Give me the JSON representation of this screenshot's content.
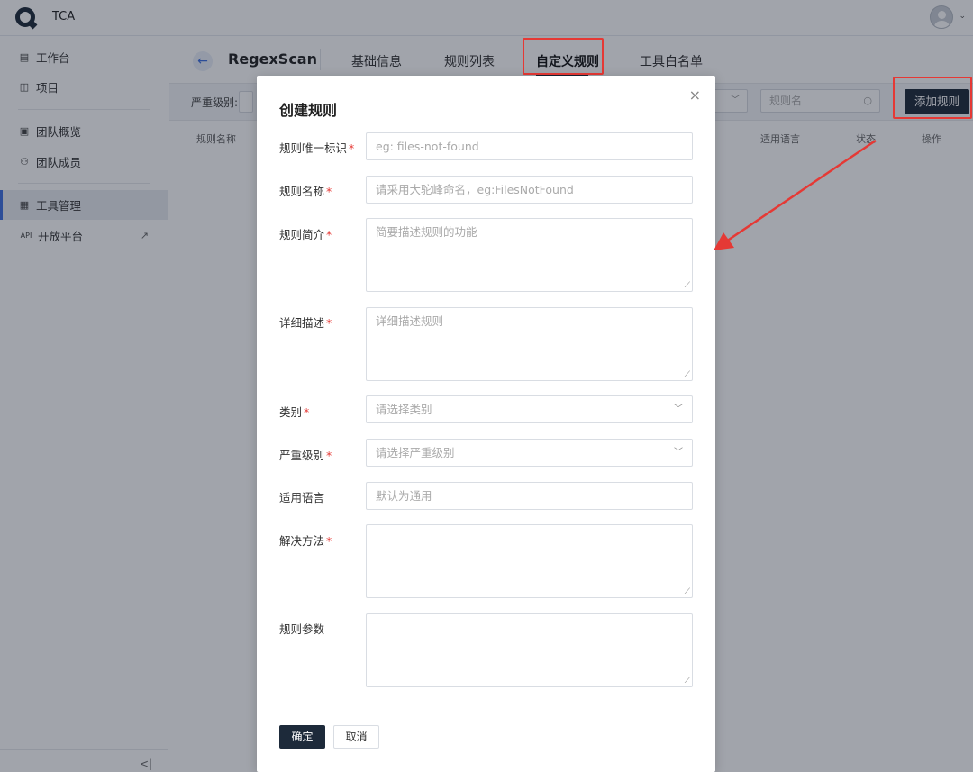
{
  "app": {
    "brand": "TCA"
  },
  "sidebar": {
    "items": [
      {
        "icon": "▤",
        "label": "工作台"
      },
      {
        "icon": "◫",
        "label": "项目"
      },
      {
        "icon": "▣",
        "label": "团队概览"
      },
      {
        "icon": "⚇",
        "label": "团队成员"
      },
      {
        "icon": "▦",
        "label": "工具管理"
      },
      {
        "icon": "API",
        "label": "开放平台",
        "ext": "↗"
      }
    ],
    "collapse": "<|"
  },
  "header": {
    "back_icon": "←",
    "tool_name": "RegexScan",
    "tabs": [
      "基础信息",
      "规则列表",
      "自定义规则",
      "工具白名单"
    ],
    "active_tab": "自定义规则"
  },
  "filter": {
    "severity_label": "严重级别:",
    "search_placeholder": "规则名",
    "add_button": "添加规则"
  },
  "table": {
    "columns": [
      "规则名称",
      "适用语言",
      "状态",
      "操作"
    ]
  },
  "modal": {
    "title": "创建规则",
    "close": "×",
    "fields": [
      {
        "label": "规则唯一标识",
        "required": "*",
        "placeholder": "eg: files-not-found"
      },
      {
        "label": "规则名称",
        "required": "*",
        "placeholder": "请采用大驼峰命名，eg:FilesNotFound"
      },
      {
        "label": "规则简介",
        "required": "*",
        "placeholder": "简要描述规则的功能"
      },
      {
        "label": "详细描述",
        "required": "*",
        "placeholder": "详细描述规则"
      },
      {
        "label": "类别",
        "required": "*",
        "placeholder": "请选择类别"
      },
      {
        "label": "严重级别",
        "required": "*",
        "placeholder": "请选择严重级别"
      },
      {
        "label": "适用语言",
        "required": "",
        "placeholder": "默认为通用"
      },
      {
        "label": "解决方法",
        "required": "*",
        "placeholder": ""
      },
      {
        "label": "规则参数",
        "required": "",
        "placeholder": ""
      }
    ],
    "ok": "确定",
    "cancel": "取消"
  },
  "colors": {
    "primary": "#1d2a3a",
    "accent": "#3d6fe0",
    "highlight": "#e53935"
  }
}
